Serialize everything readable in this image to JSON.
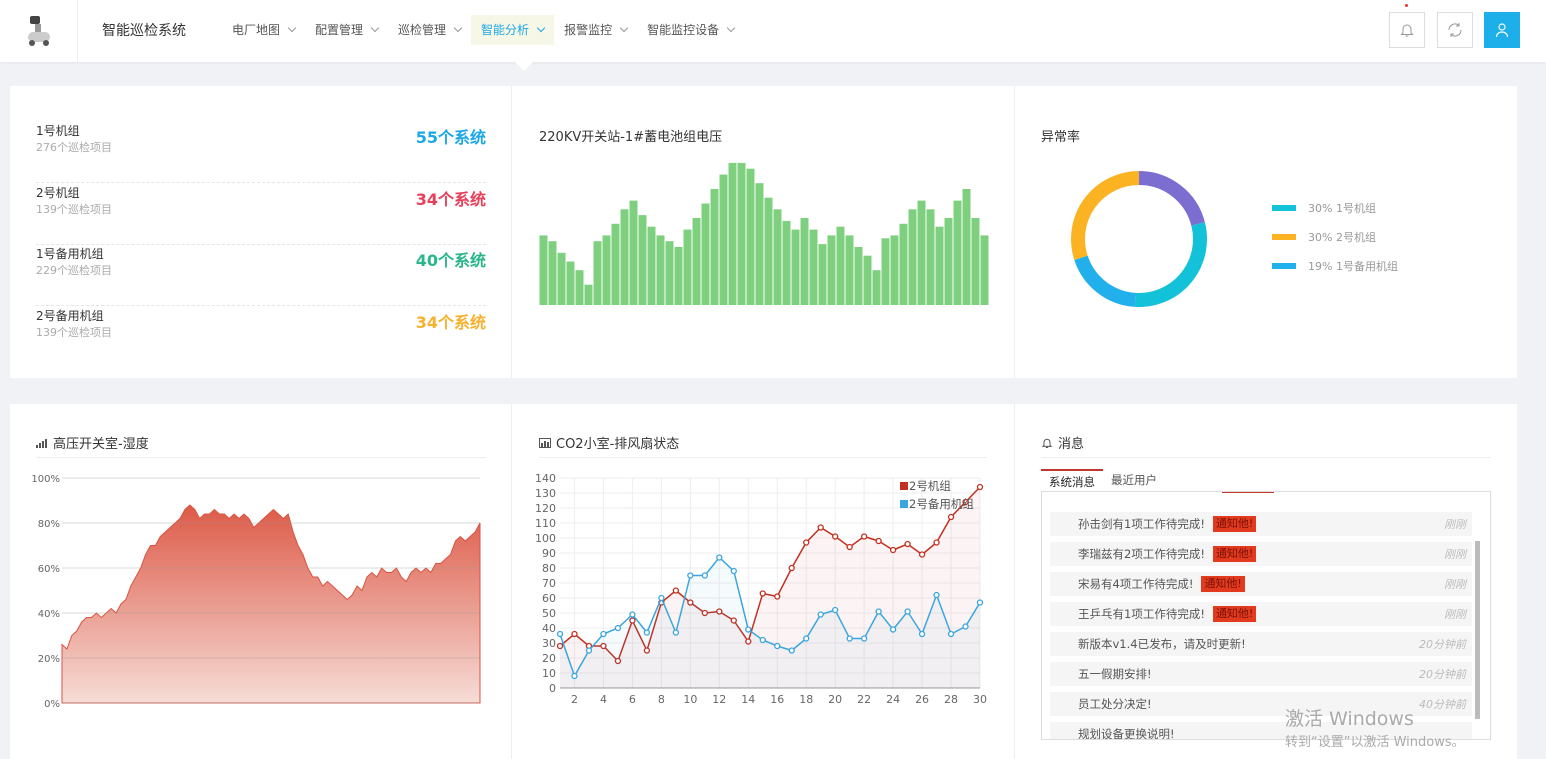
{
  "app": {
    "title": "智能巡检系统"
  },
  "nav": [
    {
      "label": "电厂地图",
      "active": false
    },
    {
      "label": "配置管理",
      "active": false
    },
    {
      "label": "巡检管理",
      "active": false
    },
    {
      "label": "智能分析",
      "active": true
    },
    {
      "label": "报警监控",
      "active": false
    },
    {
      "label": "智能监控设备",
      "active": false
    }
  ],
  "groups": [
    {
      "name": "1号机组",
      "sub": "276个巡检项目",
      "value": "55个系统",
      "color": "#1ca8e8"
    },
    {
      "name": "2号机组",
      "sub": "139个巡检项目",
      "value": "34个系统",
      "color": "#e6405a"
    },
    {
      "name": "1号备用机组",
      "sub": "229个巡检项目",
      "value": "40个系统",
      "color": "#2bb58a"
    },
    {
      "name": "2号备用机组",
      "sub": "139个巡检项目",
      "value": "34个系统",
      "color": "#f5b22f"
    }
  ],
  "voltage": {
    "title": "220KV开关站-1#蓄电池组电压",
    "color": "#7ed07f"
  },
  "abnormal": {
    "title": "异常率",
    "legend": [
      {
        "label": "30% 1号机组",
        "color": "#13c2d8"
      },
      {
        "label": "30% 2号机组",
        "color": "#fbb324"
      },
      {
        "label": "19% 1号备用机组",
        "color": "#21b0ec"
      }
    ]
  },
  "humidity": {
    "title": "高压开关室-湿度"
  },
  "fan": {
    "title": "CO2小室-排风扇状态"
  },
  "messages": {
    "title": "消息",
    "tabs": [
      "系统消息",
      "最近用户"
    ],
    "items": [
      {
        "text": "孙击剑有1项工作待完成!",
        "tag": "通知他!",
        "time": "刚刚"
      },
      {
        "text": "李瑞兹有2项工作待完成!",
        "tag": "通知他!",
        "time": "刚刚"
      },
      {
        "text": "宋易有4项工作待完成!",
        "tag": "通知他!",
        "time": "刚刚"
      },
      {
        "text": "王乒乓有1项工作待完成!",
        "tag": "通知他!",
        "time": "刚刚"
      },
      {
        "text": "新版本v1.4已发布，请及时更新!",
        "tag": "",
        "time": "20分钟前"
      },
      {
        "text": "五一假期安排!",
        "tag": "",
        "time": "20分钟前"
      },
      {
        "text": "员工处分决定!",
        "tag": "",
        "time": "40分钟前"
      },
      {
        "text": "规划设备更换说明!",
        "tag": "",
        "time": ""
      }
    ]
  },
  "watermark": {
    "line1": "激活 Windows",
    "line2": "转到“设置”以激活 Windows。"
  },
  "chart_data": [
    {
      "type": "bar",
      "title": "220KV开关站-1#蓄电池组电压",
      "values": [
        48,
        44,
        36,
        30,
        24,
        14,
        44,
        48,
        56,
        66,
        72,
        62,
        54,
        48,
        44,
        40,
        52,
        60,
        70,
        80,
        90,
        98,
        98,
        94,
        84,
        74,
        66,
        58,
        52,
        60,
        52,
        42,
        48,
        54,
        48,
        40,
        34,
        24,
        46,
        48,
        56,
        66,
        72,
        66,
        54,
        60,
        72,
        80,
        60,
        48
      ]
    },
    {
      "type": "donut",
      "title": "异常率",
      "series": [
        {
          "name": "30% 1号机组",
          "value": 30,
          "color": "#13c2d8"
        },
        {
          "name": "30% 2号机组",
          "value": 30,
          "color": "#fbb324"
        },
        {
          "name": "19% 1号备用机组",
          "value": 19,
          "color": "#21b0ec"
        },
        {
          "name": "",
          "value": 21,
          "color": "#7c6dd0"
        }
      ]
    },
    {
      "type": "area",
      "title": "高压开关室-湿度",
      "ylim": [
        0,
        100
      ],
      "yticks": [
        "0%",
        "20%",
        "40%",
        "60%",
        "80%",
        "100%"
      ],
      "values": [
        26,
        24,
        30,
        32,
        36,
        38,
        38,
        40,
        38,
        40,
        42,
        40,
        44,
        46,
        52,
        56,
        60,
        66,
        70,
        70,
        74,
        76,
        78,
        80,
        82,
        86,
        88,
        86,
        82,
        84,
        84,
        86,
        84,
        84,
        82,
        84,
        82,
        84,
        82,
        78,
        80,
        82,
        84,
        86,
        84,
        82,
        84,
        76,
        70,
        66,
        60,
        56,
        56,
        52,
        54,
        52,
        50,
        48,
        46,
        48,
        52,
        50,
        56,
        58,
        56,
        60,
        58,
        58,
        60,
        56,
        54,
        58,
        60,
        58,
        60,
        58,
        62,
        62,
        64,
        66,
        72,
        74,
        72,
        74,
        76,
        80
      ]
    },
    {
      "type": "line",
      "title": "CO2小室-排风扇状态",
      "ylim": [
        0,
        140
      ],
      "x": [
        1,
        2,
        3,
        4,
        5,
        6,
        7,
        8,
        9,
        10,
        11,
        12,
        13,
        14,
        15,
        16,
        17,
        18,
        19,
        20,
        21,
        22,
        23,
        24,
        25,
        26,
        27,
        28,
        29,
        30
      ],
      "xticks": [
        2,
        4,
        6,
        8,
        10,
        12,
        14,
        16,
        18,
        20,
        22,
        24,
        26,
        28,
        30
      ],
      "yticks": [
        0,
        10,
        20,
        30,
        40,
        50,
        60,
        70,
        80,
        90,
        100,
        110,
        120,
        130,
        140
      ],
      "series": [
        {
          "name": "2号机组",
          "color": "#c23021",
          "values": [
            28,
            36,
            28,
            28,
            18,
            45,
            25,
            57,
            65,
            57,
            50,
            51,
            45,
            31,
            63,
            61,
            80,
            97,
            107,
            101,
            94,
            101,
            98,
            92,
            96,
            89,
            97,
            114,
            124,
            134
          ]
        },
        {
          "name": "2号备用机组",
          "color": "#3aa6dd",
          "values": [
            36,
            8,
            25,
            36,
            40,
            49,
            37,
            60,
            37,
            75,
            75,
            87,
            78,
            39,
            32,
            28,
            25,
            33,
            49,
            52,
            33,
            33,
            51,
            39,
            51,
            36,
            62,
            36,
            41,
            57
          ]
        }
      ]
    }
  ]
}
